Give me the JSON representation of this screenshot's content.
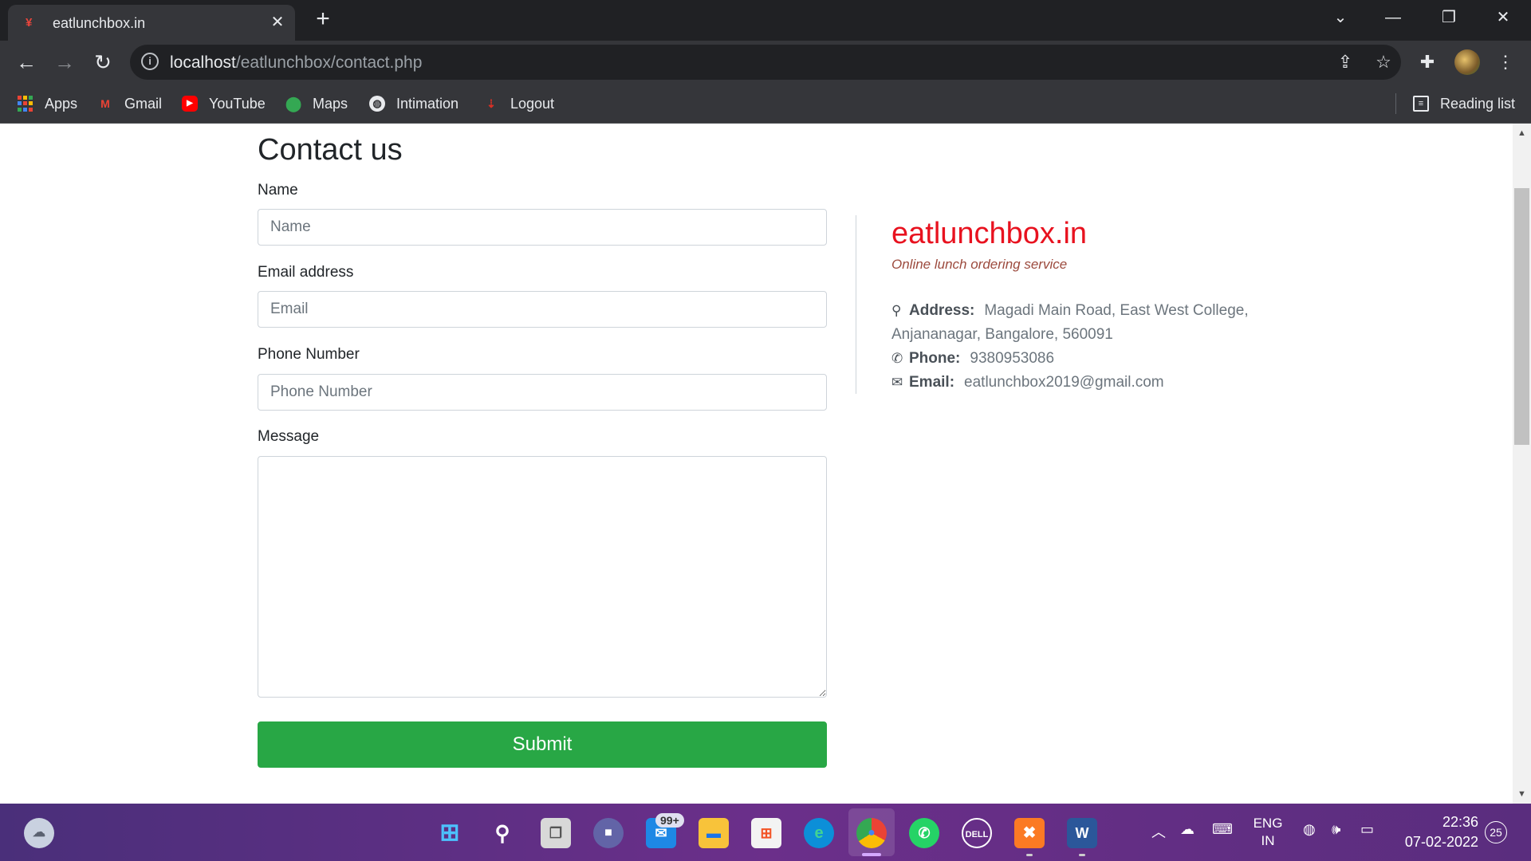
{
  "browser": {
    "tab_title": "eatlunchbox.in",
    "tab_favicon": "fork-knife-icon",
    "url_host": "localhost",
    "url_path": "/eatlunchbox/contact.php",
    "bookmarks": [
      {
        "label": "Apps",
        "icon": "apps-grid-icon"
      },
      {
        "label": "Gmail",
        "icon": "gmail-icon"
      },
      {
        "label": "YouTube",
        "icon": "youtube-icon"
      },
      {
        "label": "Maps",
        "icon": "maps-icon"
      },
      {
        "label": "Intimation",
        "icon": "globe-icon"
      },
      {
        "label": "Logout",
        "icon": "logout-icon"
      }
    ],
    "reading_list": "Reading list"
  },
  "form": {
    "heading": "Contact us",
    "name_label": "Name",
    "name_placeholder": "Name",
    "email_label": "Email address",
    "email_placeholder": "Email",
    "phone_label": "Phone Number",
    "phone_placeholder": "Phone Number",
    "message_label": "Message",
    "submit_label": "Submit"
  },
  "contact_info": {
    "brand": "eatlunchbox.in",
    "tagline": "Online lunch ordering service",
    "address_label": "Address:",
    "address_line1": "Magadi Main Road, East West College,",
    "address_line2": "Anjananagar, Bangalore, 560091",
    "phone_label": "Phone:",
    "phone_value": "9380953086",
    "email_label": "Email:",
    "email_value": "eatlunchbox2019@gmail.com"
  },
  "taskbar": {
    "mail_badge": "99+",
    "language_line1": "ENG",
    "language_line2": "IN",
    "time": "22:36",
    "date": "07-02-2022",
    "notification_count": "25"
  },
  "colors": {
    "brand": "#e8121f",
    "submit": "#28a745",
    "chrome_dark": "#202124",
    "chrome_mid": "#35363a"
  }
}
